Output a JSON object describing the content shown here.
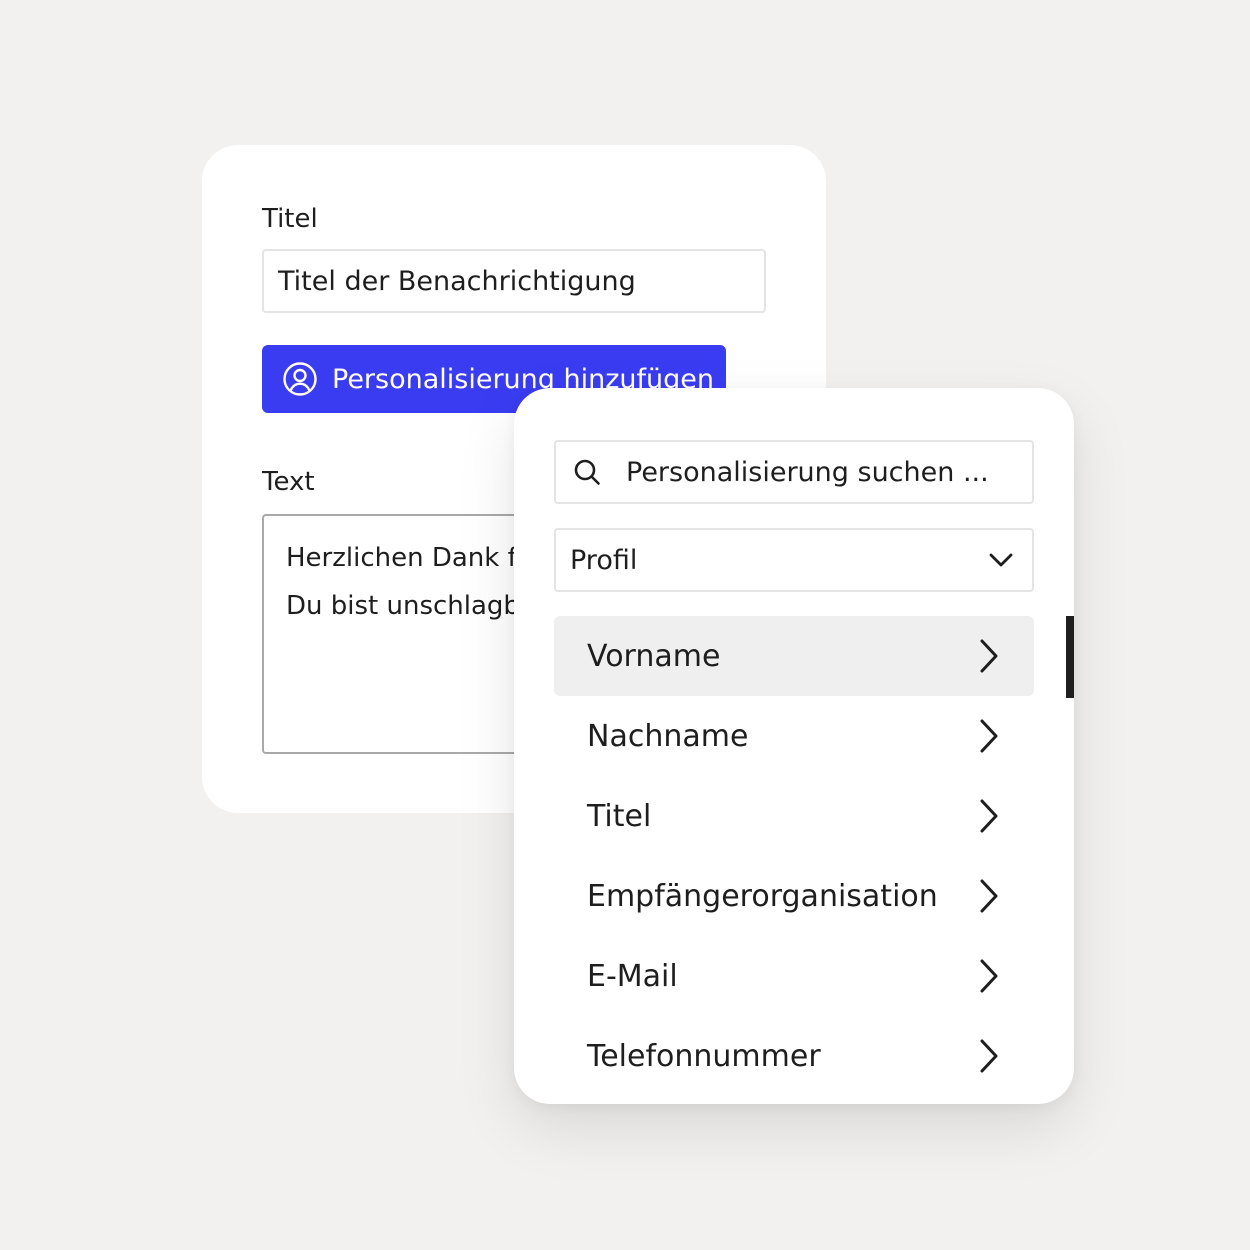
{
  "form": {
    "title_label": "Titel",
    "title_value": "Titel der Benachrichtigung",
    "personalize_button": "Personalisierung hinzufügen",
    "text_label": "Text",
    "text_lines": [
      "Herzlichen Dank f",
      "Du bist unschlagb"
    ]
  },
  "picker": {
    "search_placeholder": "Personalisierung suchen ...",
    "category": "Profil",
    "items": [
      {
        "label": "Vorname",
        "active": true
      },
      {
        "label": "Nachname",
        "active": false
      },
      {
        "label": "Titel",
        "active": false
      },
      {
        "label": "Empfängerorganisation",
        "active": false
      },
      {
        "label": "E-Mail",
        "active": false
      },
      {
        "label": "Telefonnummer",
        "active": false
      }
    ]
  },
  "colors": {
    "background": "#f2f1ef",
    "accent": "#3a3cf2",
    "active_row": "#efefef",
    "text": "#1e1e1e"
  },
  "icons": {
    "personalize": "user-circle-icon",
    "search": "search-icon",
    "select": "chevron-down-icon",
    "item": "chevron-right-icon"
  }
}
